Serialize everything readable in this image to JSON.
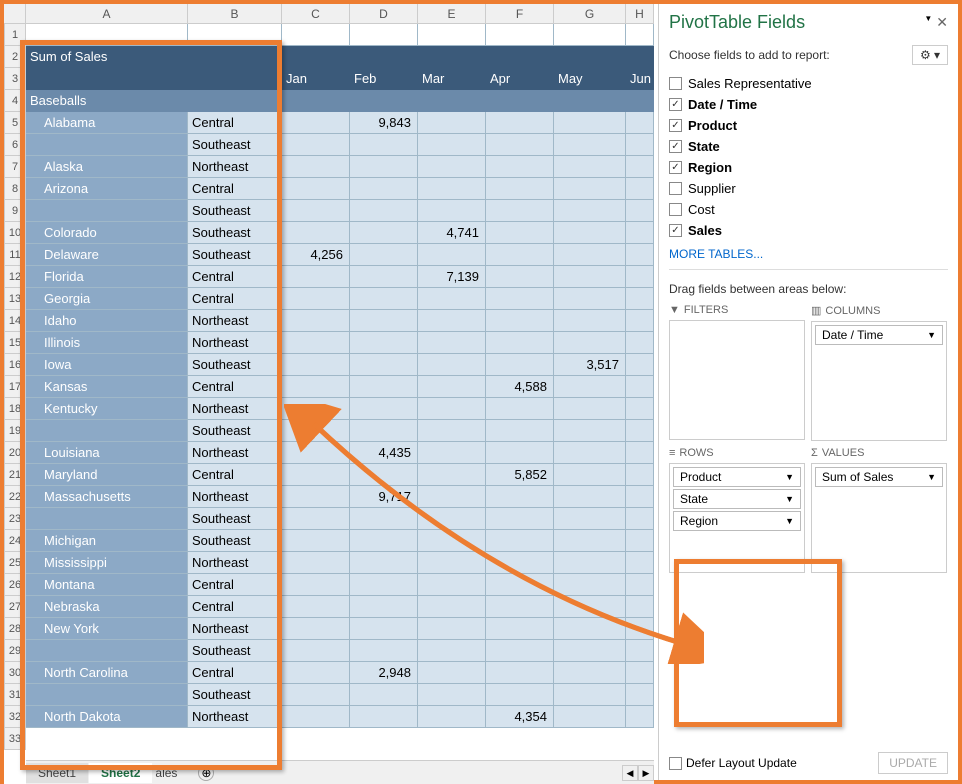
{
  "columns": [
    "A",
    "B",
    "C",
    "D",
    "E",
    "F",
    "G",
    "H"
  ],
  "rowNums": [
    1,
    2,
    3,
    4,
    5,
    6,
    7,
    8,
    9,
    10,
    11,
    12,
    13,
    14,
    15,
    16,
    17,
    18,
    19,
    20,
    21,
    22,
    23,
    24,
    25,
    26,
    27,
    28,
    29,
    30,
    31,
    32,
    33
  ],
  "pivot": {
    "title": "Sum of Sales",
    "months": [
      "Jan",
      "Feb",
      "Mar",
      "Apr",
      "May",
      "Jun"
    ],
    "group": "Baseballs",
    "rows": [
      {
        "state": "Alabama",
        "region": "Central",
        "vals": {
          "D": "9,843"
        }
      },
      {
        "state": "",
        "region": "Southeast",
        "vals": {}
      },
      {
        "state": "Alaska",
        "region": "Northeast",
        "vals": {}
      },
      {
        "state": "Arizona",
        "region": "Central",
        "vals": {}
      },
      {
        "state": "",
        "region": "Southeast",
        "vals": {}
      },
      {
        "state": "Colorado",
        "region": "Southeast",
        "vals": {
          "E": "4,741"
        }
      },
      {
        "state": "Delaware",
        "region": "Southeast",
        "vals": {
          "C": "4,256"
        }
      },
      {
        "state": "Florida",
        "region": "Central",
        "vals": {
          "E": "7,139"
        }
      },
      {
        "state": "Georgia",
        "region": "Central",
        "vals": {}
      },
      {
        "state": "Idaho",
        "region": "Northeast",
        "vals": {}
      },
      {
        "state": "Illinois",
        "region": "Northeast",
        "vals": {}
      },
      {
        "state": "Iowa",
        "region": "Southeast",
        "vals": {
          "G": "3,517"
        }
      },
      {
        "state": "Kansas",
        "region": "Central",
        "vals": {
          "F": "4,588"
        }
      },
      {
        "state": "Kentucky",
        "region": "Northeast",
        "vals": {}
      },
      {
        "state": "",
        "region": "Southeast",
        "vals": {}
      },
      {
        "state": "Louisiana",
        "region": "Northeast",
        "vals": {
          "D": "4,435"
        }
      },
      {
        "state": "Maryland",
        "region": "Central",
        "vals": {
          "F": "5,852"
        }
      },
      {
        "state": "Massachusetts",
        "region": "Northeast",
        "vals": {
          "D": "9,717"
        }
      },
      {
        "state": "",
        "region": "Southeast",
        "vals": {}
      },
      {
        "state": "Michigan",
        "region": "Southeast",
        "vals": {}
      },
      {
        "state": "Mississippi",
        "region": "Northeast",
        "vals": {}
      },
      {
        "state": "Montana",
        "region": "Central",
        "vals": {}
      },
      {
        "state": "Nebraska",
        "region": "Central",
        "vals": {}
      },
      {
        "state": "New York",
        "region": "Northeast",
        "vals": {}
      },
      {
        "state": "",
        "region": "Southeast",
        "vals": {}
      },
      {
        "state": "North Carolina",
        "region": "Central",
        "vals": {
          "D": "2,948"
        }
      },
      {
        "state": "",
        "region": "Southeast",
        "vals": {}
      },
      {
        "state": "North Dakota",
        "region": "Northeast",
        "vals": {
          "F": "4,354"
        }
      }
    ]
  },
  "tabs": {
    "sheet1": "Sheet1",
    "sheet2": "Sheet2",
    "ales": "ales"
  },
  "pane": {
    "title": "PivotTable Fields",
    "subtitle": "Choose fields to add to report:",
    "fields": [
      {
        "label": "Sales Representative",
        "checked": false
      },
      {
        "label": "Date / Time",
        "checked": true
      },
      {
        "label": "Product",
        "checked": true
      },
      {
        "label": "State",
        "checked": true
      },
      {
        "label": "Region",
        "checked": true
      },
      {
        "label": "Supplier",
        "checked": false
      },
      {
        "label": "Cost",
        "checked": false
      },
      {
        "label": "Sales",
        "checked": true
      }
    ],
    "more": "MORE TABLES...",
    "dragHint": "Drag fields between areas below:",
    "areas": {
      "filters": "FILTERS",
      "columns": "COLUMNS",
      "rows": "ROWS",
      "values": "VALUES"
    },
    "colItems": [
      "Date / Time"
    ],
    "rowItems": [
      "Product",
      "State",
      "Region"
    ],
    "valItems": [
      "Sum of Sales"
    ],
    "defer": "Defer Layout Update",
    "update": "UPDATE"
  }
}
